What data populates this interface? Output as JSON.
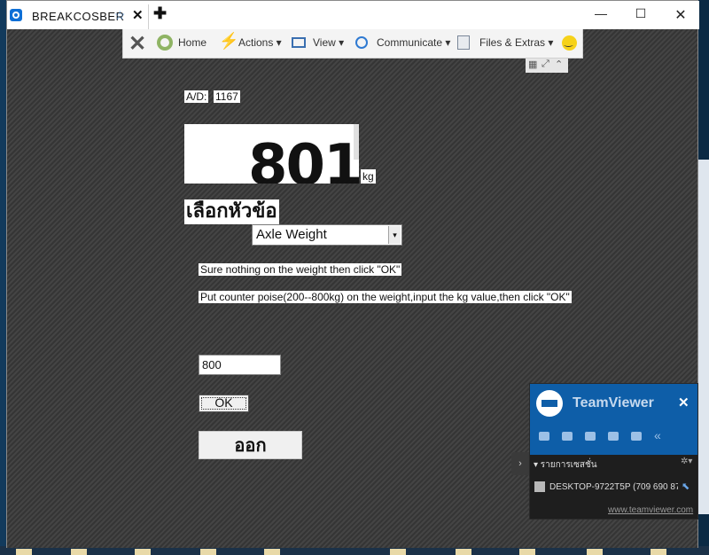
{
  "browser": {
    "tab_title": "BREAKCOSBER",
    "star_icon": "star-icon",
    "close_glyph": "✕",
    "new_tab_glyph": "✚",
    "window_controls": {
      "minimize": "—",
      "maximize": "☐",
      "close": "✕"
    }
  },
  "toolbar": {
    "close_glyph": "✕",
    "home": "Home",
    "actions": "Actions ▾",
    "view": "View ▾",
    "communicate": "Communicate ▾",
    "files": "Files & Extras ▾"
  },
  "mini_controls": {
    "grid": "▦",
    "resize": "⤢",
    "collapse": "⌃"
  },
  "remote_app": {
    "ad_label": "A/D:",
    "ad_value": "1167",
    "weight_value": "801",
    "unit": "kg",
    "topic_title": "เลือกหัวข้อ",
    "selected_topic": "Axle Weight",
    "select_arrow": "▾",
    "instruction_1": "Sure nothing on the weight then click \"OK\"",
    "instruction_2": "Put counter poise(200--800kg) on the weight,input the kg value,then click \"OK\"",
    "kg_input_value": "800",
    "ok_label": "OK",
    "exit_label": "ออก"
  },
  "teamviewer_panel": {
    "name": "TeamViewer",
    "close_glyph": "✕",
    "chevrons": "«",
    "collapse_arrow": "›",
    "sessions_label": "▾ รายการเซสชั่น",
    "gear_glyph": "✲▾",
    "session_text": "DESKTOP-9722T5P (709 690 87",
    "pointer_glyph": "⬉",
    "link": "www.teamviewer.com"
  },
  "colors": {
    "teamviewer_blue": "#0e5ea8",
    "remote_background": "#3b3b3b"
  }
}
